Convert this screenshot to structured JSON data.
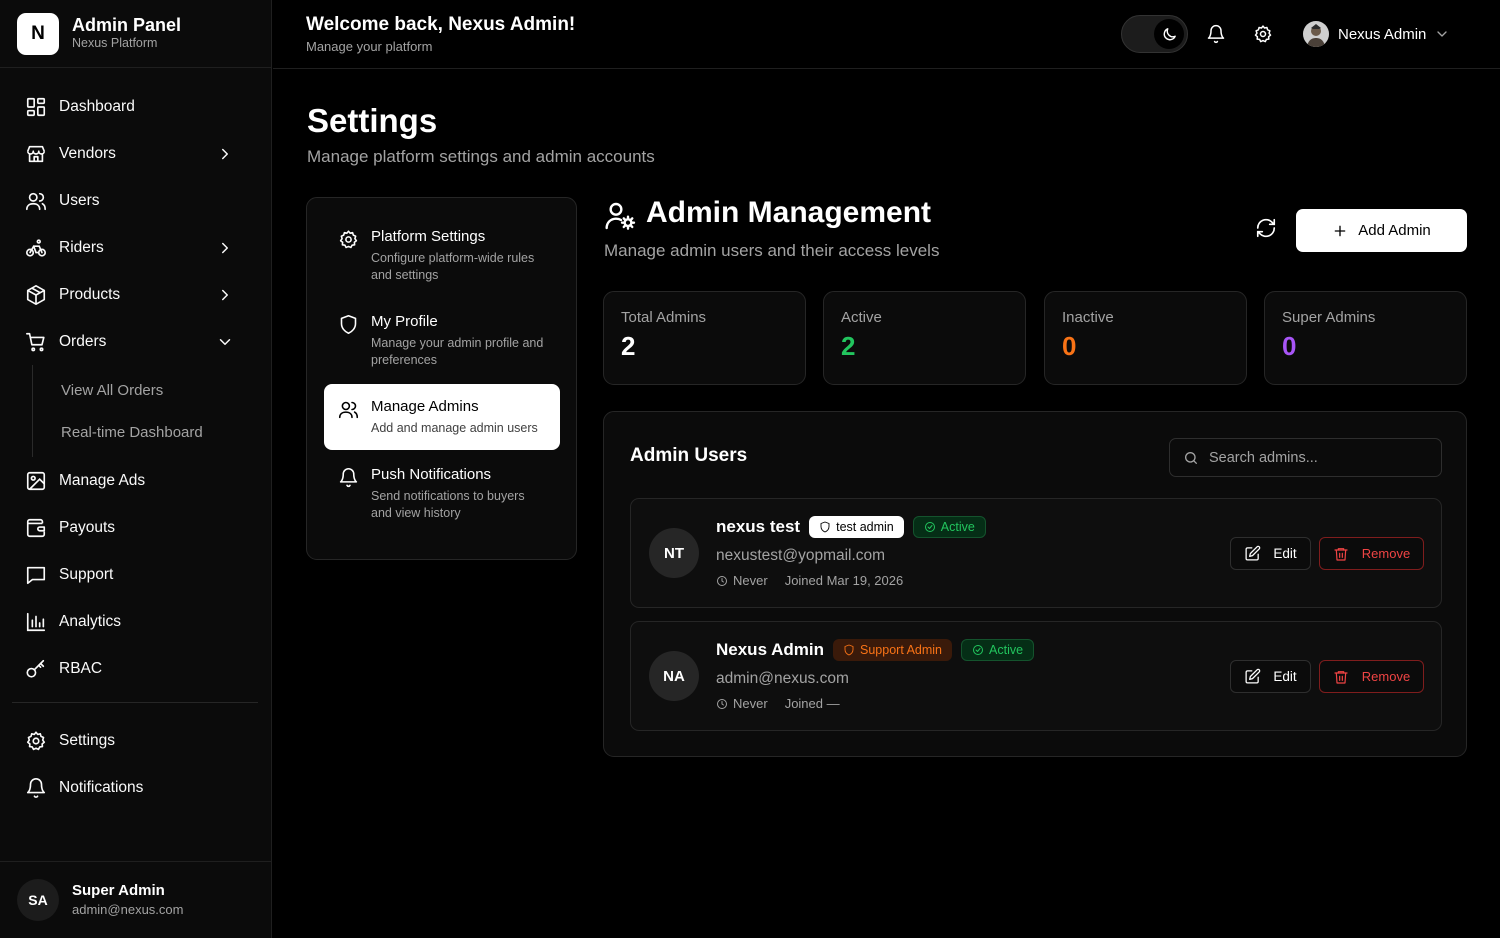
{
  "brand": {
    "logo_letter": "N",
    "title": "Admin Panel",
    "subtitle": "Nexus Platform"
  },
  "sidebar": {
    "items": [
      {
        "label": "Dashboard",
        "icon": "dashboard-grid-icon"
      },
      {
        "label": "Vendors",
        "icon": "store-icon",
        "chevron": "right"
      },
      {
        "label": "Users",
        "icon": "users-icon"
      },
      {
        "label": "Riders",
        "icon": "bike-icon",
        "chevron": "right"
      },
      {
        "label": "Products",
        "icon": "package-icon",
        "chevron": "right"
      },
      {
        "label": "Orders",
        "icon": "cart-icon",
        "chevron": "down",
        "expanded": true
      }
    ],
    "orders_sub": [
      "View All Orders",
      "Real-time Dashboard"
    ],
    "items_after": [
      {
        "label": "Manage Ads",
        "icon": "image-icon"
      },
      {
        "label": "Payouts",
        "icon": "wallet-icon"
      },
      {
        "label": "Support",
        "icon": "message-square-icon"
      },
      {
        "label": "Analytics",
        "icon": "bar-chart-icon"
      },
      {
        "label": "RBAC",
        "icon": "key-icon"
      }
    ],
    "bottom_items": [
      {
        "label": "Settings",
        "icon": "gear-icon"
      },
      {
        "label": "Notifications",
        "icon": "bell-icon"
      }
    ],
    "user": {
      "initials": "SA",
      "name": "Super Admin",
      "email": "admin@nexus.com"
    }
  },
  "header": {
    "welcome": "Welcome back, Nexus Admin!",
    "subtitle": "Manage your platform",
    "profile_name": "Nexus Admin"
  },
  "page": {
    "title": "Settings",
    "subtitle": "Manage platform settings and admin accounts"
  },
  "settings_menu": [
    {
      "title": "Platform Settings",
      "desc": "Configure platform-wide rules and settings",
      "icon": "gear-icon",
      "active": false
    },
    {
      "title": "My Profile",
      "desc": "Manage your admin profile and preferences",
      "icon": "shield-icon",
      "active": false
    },
    {
      "title": "Manage Admins",
      "desc": "Add and manage admin users",
      "icon": "users-icon",
      "active": true
    },
    {
      "title": "Push Notifications",
      "desc": "Send notifications to buyers and view history",
      "icon": "bell-icon",
      "active": false
    }
  ],
  "admin_management": {
    "title": "Admin Management",
    "subtitle": "Manage admin users and their access levels",
    "add_button": "Add Admin"
  },
  "stats": [
    {
      "label": "Total Admins",
      "value": "2",
      "color": "#ffffff"
    },
    {
      "label": "Active",
      "value": "2",
      "color": "#22c55e"
    },
    {
      "label": "Inactive",
      "value": "0",
      "color": "#f97316"
    },
    {
      "label": "Super Admins",
      "value": "0",
      "color": "#a855f7"
    }
  ],
  "admin_users": {
    "title": "Admin Users",
    "search_placeholder": "Search admins...",
    "rows": [
      {
        "initials": "NT",
        "name": "nexus test",
        "role": "test admin",
        "role_style": "white",
        "status": "Active",
        "email": "nexustest@yopmail.com",
        "last_login": "Never",
        "joined": "Joined Mar 19, 2026"
      },
      {
        "initials": "NA",
        "name": "Nexus Admin",
        "role": "Support Admin",
        "role_style": "orange",
        "status": "Active",
        "email": "admin@nexus.com",
        "last_login": "Never",
        "joined": "Joined —"
      }
    ],
    "edit_label": "Edit",
    "remove_label": "Remove"
  }
}
